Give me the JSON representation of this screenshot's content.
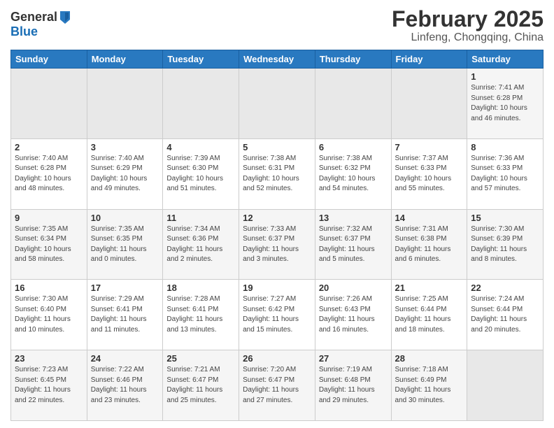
{
  "header": {
    "logo_general": "General",
    "logo_blue": "Blue",
    "main_title": "February 2025",
    "subtitle": "Linfeng, Chongqing, China"
  },
  "days_of_week": [
    "Sunday",
    "Monday",
    "Tuesday",
    "Wednesday",
    "Thursday",
    "Friday",
    "Saturday"
  ],
  "weeks": [
    [
      {
        "day": "",
        "info": ""
      },
      {
        "day": "",
        "info": ""
      },
      {
        "day": "",
        "info": ""
      },
      {
        "day": "",
        "info": ""
      },
      {
        "day": "",
        "info": ""
      },
      {
        "day": "",
        "info": ""
      },
      {
        "day": "1",
        "info": "Sunrise: 7:41 AM\nSunset: 6:28 PM\nDaylight: 10 hours and 46 minutes."
      }
    ],
    [
      {
        "day": "2",
        "info": "Sunrise: 7:40 AM\nSunset: 6:28 PM\nDaylight: 10 hours and 48 minutes."
      },
      {
        "day": "3",
        "info": "Sunrise: 7:40 AM\nSunset: 6:29 PM\nDaylight: 10 hours and 49 minutes."
      },
      {
        "day": "4",
        "info": "Sunrise: 7:39 AM\nSunset: 6:30 PM\nDaylight: 10 hours and 51 minutes."
      },
      {
        "day": "5",
        "info": "Sunrise: 7:38 AM\nSunset: 6:31 PM\nDaylight: 10 hours and 52 minutes."
      },
      {
        "day": "6",
        "info": "Sunrise: 7:38 AM\nSunset: 6:32 PM\nDaylight: 10 hours and 54 minutes."
      },
      {
        "day": "7",
        "info": "Sunrise: 7:37 AM\nSunset: 6:33 PM\nDaylight: 10 hours and 55 minutes."
      },
      {
        "day": "8",
        "info": "Sunrise: 7:36 AM\nSunset: 6:33 PM\nDaylight: 10 hours and 57 minutes."
      }
    ],
    [
      {
        "day": "9",
        "info": "Sunrise: 7:35 AM\nSunset: 6:34 PM\nDaylight: 10 hours and 58 minutes."
      },
      {
        "day": "10",
        "info": "Sunrise: 7:35 AM\nSunset: 6:35 PM\nDaylight: 11 hours and 0 minutes."
      },
      {
        "day": "11",
        "info": "Sunrise: 7:34 AM\nSunset: 6:36 PM\nDaylight: 11 hours and 2 minutes."
      },
      {
        "day": "12",
        "info": "Sunrise: 7:33 AM\nSunset: 6:37 PM\nDaylight: 11 hours and 3 minutes."
      },
      {
        "day": "13",
        "info": "Sunrise: 7:32 AM\nSunset: 6:37 PM\nDaylight: 11 hours and 5 minutes."
      },
      {
        "day": "14",
        "info": "Sunrise: 7:31 AM\nSunset: 6:38 PM\nDaylight: 11 hours and 6 minutes."
      },
      {
        "day": "15",
        "info": "Sunrise: 7:30 AM\nSunset: 6:39 PM\nDaylight: 11 hours and 8 minutes."
      }
    ],
    [
      {
        "day": "16",
        "info": "Sunrise: 7:30 AM\nSunset: 6:40 PM\nDaylight: 11 hours and 10 minutes."
      },
      {
        "day": "17",
        "info": "Sunrise: 7:29 AM\nSunset: 6:41 PM\nDaylight: 11 hours and 11 minutes."
      },
      {
        "day": "18",
        "info": "Sunrise: 7:28 AM\nSunset: 6:41 PM\nDaylight: 11 hours and 13 minutes."
      },
      {
        "day": "19",
        "info": "Sunrise: 7:27 AM\nSunset: 6:42 PM\nDaylight: 11 hours and 15 minutes."
      },
      {
        "day": "20",
        "info": "Sunrise: 7:26 AM\nSunset: 6:43 PM\nDaylight: 11 hours and 16 minutes."
      },
      {
        "day": "21",
        "info": "Sunrise: 7:25 AM\nSunset: 6:44 PM\nDaylight: 11 hours and 18 minutes."
      },
      {
        "day": "22",
        "info": "Sunrise: 7:24 AM\nSunset: 6:44 PM\nDaylight: 11 hours and 20 minutes."
      }
    ],
    [
      {
        "day": "23",
        "info": "Sunrise: 7:23 AM\nSunset: 6:45 PM\nDaylight: 11 hours and 22 minutes."
      },
      {
        "day": "24",
        "info": "Sunrise: 7:22 AM\nSunset: 6:46 PM\nDaylight: 11 hours and 23 minutes."
      },
      {
        "day": "25",
        "info": "Sunrise: 7:21 AM\nSunset: 6:47 PM\nDaylight: 11 hours and 25 minutes."
      },
      {
        "day": "26",
        "info": "Sunrise: 7:20 AM\nSunset: 6:47 PM\nDaylight: 11 hours and 27 minutes."
      },
      {
        "day": "27",
        "info": "Sunrise: 7:19 AM\nSunset: 6:48 PM\nDaylight: 11 hours and 29 minutes."
      },
      {
        "day": "28",
        "info": "Sunrise: 7:18 AM\nSunset: 6:49 PM\nDaylight: 11 hours and 30 minutes."
      },
      {
        "day": "",
        "info": ""
      }
    ]
  ]
}
